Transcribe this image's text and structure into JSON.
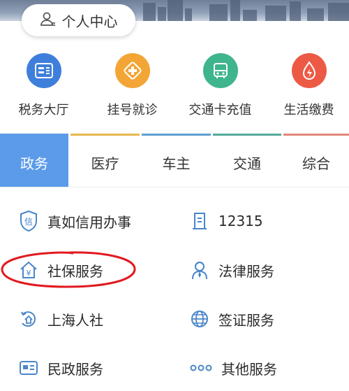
{
  "header": {
    "personal_center": "个人中心"
  },
  "quick_services": [
    {
      "label": "税务大厅",
      "icon": "tax-hall-icon",
      "color": "#3f7fdc"
    },
    {
      "label": "挂号就诊",
      "icon": "medical-registration-icon",
      "color": "#f3a535"
    },
    {
      "label": "交通卡充值",
      "icon": "bus-card-icon",
      "color": "#3fb58d"
    },
    {
      "label": "生活缴费",
      "icon": "utility-payment-icon",
      "color": "#ec5a45"
    }
  ],
  "tabs": [
    {
      "label": "政务",
      "active": true,
      "color": "#5b9bea"
    },
    {
      "label": "医疗",
      "active": false,
      "color": "#e6b84e"
    },
    {
      "label": "车主",
      "active": false,
      "color": "#5f9fd0"
    },
    {
      "label": "交通",
      "active": false,
      "color": "#55a99a"
    },
    {
      "label": "综合",
      "active": false,
      "color": "#e2857a"
    }
  ],
  "services": [
    {
      "label": "真如信用办事",
      "icon": "credit-shield-icon"
    },
    {
      "label": "12315",
      "icon": "document-icon"
    },
    {
      "label": "社保服务",
      "icon": "social-security-house-icon"
    },
    {
      "label": "法律服务",
      "icon": "legal-person-icon"
    },
    {
      "label": "上海人社",
      "icon": "shanghai-hr-icon"
    },
    {
      "label": "签证服务",
      "icon": "globe-icon"
    },
    {
      "label": "民政服务",
      "icon": "id-card-icon"
    },
    {
      "label": "其他服务",
      "icon": "more-dots-icon"
    }
  ],
  "colors": {
    "icon_blue": "#4a86c8",
    "annotation_red": "#e2191f"
  }
}
